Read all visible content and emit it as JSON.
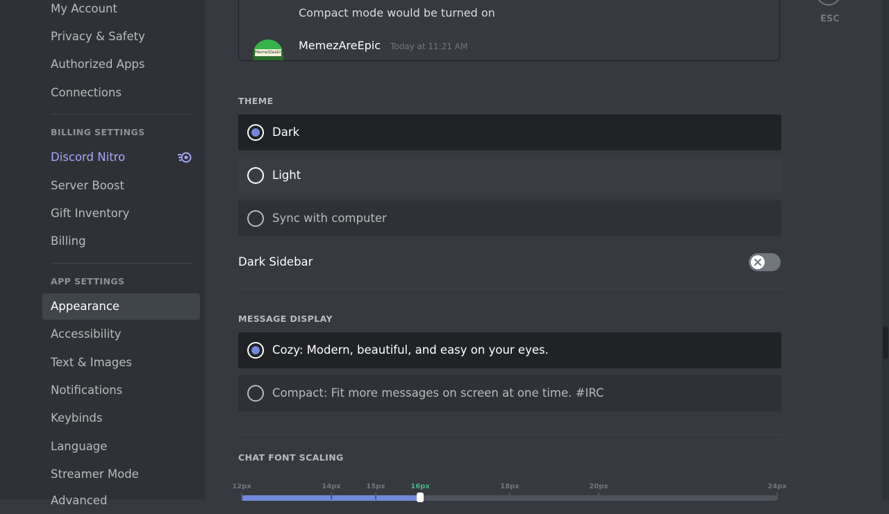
{
  "sidebar": {
    "user_items": [
      "My Account",
      "Privacy & Safety",
      "Authorized Apps",
      "Connections"
    ],
    "billing_header": "BILLING SETTINGS",
    "billing_items": [
      "Discord Nitro",
      "Server Boost",
      "Gift Inventory",
      "Billing"
    ],
    "app_header": "APP SETTINGS",
    "app_items": [
      "Appearance",
      "Accessibility",
      "Text & Images",
      "Notifications",
      "Keybinds",
      "Language",
      "Streamer Mode",
      "Advanced"
    ],
    "selected": "Appearance"
  },
  "preview": {
    "message": "Compact mode would be turned on",
    "author": "MemezAreEpic",
    "timestamp": "Today at 11:21 AM",
    "avatar_text": "MemeStealing"
  },
  "theme": {
    "header": "THEME",
    "options": [
      "Dark",
      "Light",
      "Sync with computer"
    ],
    "selected": "Dark"
  },
  "dark_sidebar": {
    "label": "Dark Sidebar",
    "enabled": false
  },
  "message_display": {
    "header": "MESSAGE DISPLAY",
    "options": [
      "Cozy: Modern, beautiful, and easy on your eyes.",
      "Compact: Fit more messages on screen at one time. #IRC"
    ],
    "selected": "Cozy: Modern, beautiful, and easy on your eyes."
  },
  "font_scaling": {
    "header": "CHAT FONT SCALING",
    "ticks": [
      "12px",
      "14px",
      "15px",
      "16px",
      "18px",
      "20px",
      "24px"
    ],
    "selected": "16px"
  },
  "close": {
    "label": "ESC"
  },
  "colors": {
    "accent": "#7289da",
    "nitro": "#a5aaf9",
    "active_tick": "#43b581",
    "background": "#36393f",
    "sidebar": "#2f3136"
  }
}
